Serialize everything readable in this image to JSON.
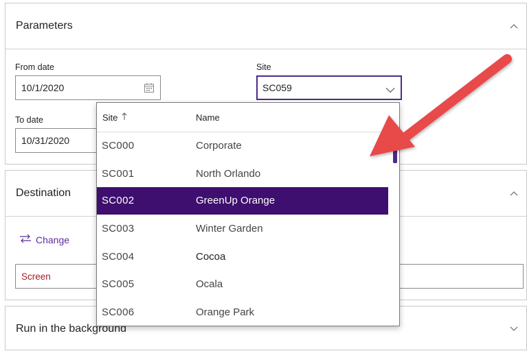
{
  "parameters": {
    "title": "Parameters",
    "from_date": {
      "label": "From date",
      "value": "10/1/2020"
    },
    "to_date": {
      "label": "To date",
      "value": "10/31/2020"
    },
    "site": {
      "label": "Site",
      "value": "SC059"
    }
  },
  "destination": {
    "title": "Destination",
    "change_label": "Change",
    "value": "Screen"
  },
  "background": {
    "title": "Run in the background"
  },
  "site_dropdown": {
    "col_site": "Site",
    "col_name": "Name",
    "rows": [
      {
        "site": "SC000",
        "name": "Corporate"
      },
      {
        "site": "SC001",
        "name": "North Orlando"
      },
      {
        "site": "SC002",
        "name": "GreenUp Orange"
      },
      {
        "site": "SC003",
        "name": "Winter Garden"
      },
      {
        "site": "SC004",
        "name": "Cocoa"
      },
      {
        "site": "SC005",
        "name": "Ocala"
      },
      {
        "site": "SC006",
        "name": "Orange Park"
      }
    ]
  },
  "icons": {
    "calendar": "calendar-icon",
    "dropdown": "chevron-down-icon",
    "collapse": "chevron-up-icon",
    "expand": "chevron-down-icon",
    "change": "swap-arrows-icon",
    "sort": "sort-ascending-icon"
  },
  "colors": {
    "accent": "#4b2a85",
    "selected_row": "#3e0f6e",
    "destination_text": "#a01f2a",
    "annotation_arrow": "#e8484a"
  }
}
